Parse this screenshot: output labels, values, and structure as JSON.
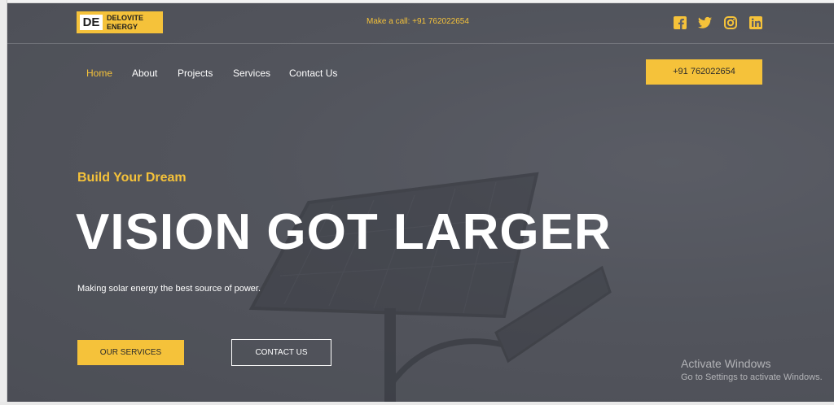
{
  "brand": {
    "mark": "DE",
    "name_line1": "DELOVITE",
    "name_line2": "ENERGY"
  },
  "topbar": {
    "call_text": "Make a call: +91 762022654"
  },
  "social": [
    "facebook-icon",
    "twitter-icon",
    "instagram-icon",
    "linkedin-icon"
  ],
  "nav": {
    "items": [
      {
        "label": "Home",
        "active": true
      },
      {
        "label": "About"
      },
      {
        "label": "Projects"
      },
      {
        "label": "Services"
      },
      {
        "label": "Contact Us"
      }
    ],
    "phone_button": "+91 762022654"
  },
  "hero": {
    "tagline": "Build Your Dream",
    "headline": "VISION GOT LARGER",
    "subtitle": "Making solar energy the best source of power.",
    "primary_button": "OUR SERVICES",
    "secondary_button": "CONTACT US"
  },
  "watermark": {
    "title": "Activate Windows",
    "subtitle": "Go to Settings to activate Windows."
  },
  "colors": {
    "accent": "#f5c23a",
    "background": "#5e6068",
    "text": "#ffffff"
  }
}
